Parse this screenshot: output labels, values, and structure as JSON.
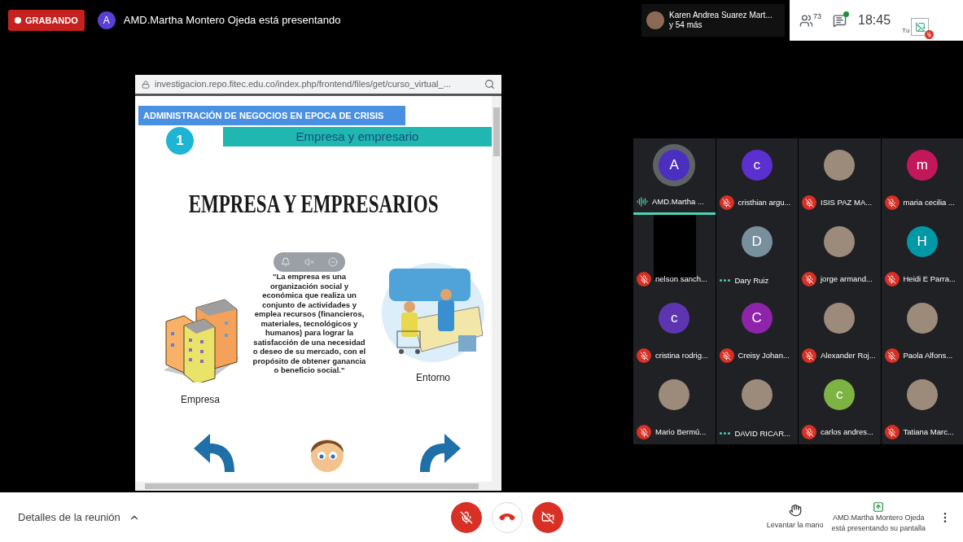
{
  "recording_badge": "GRABANDO",
  "presenter": {
    "initial": "A",
    "text": "AMD.Martha Montero Ojeda está presentando"
  },
  "pinned": {
    "name": "Karen Andrea Suarez Mart...",
    "more": "y 54 más"
  },
  "participants_count": "73",
  "chat_unread": true,
  "time": "18:45",
  "self": {
    "label": "Tú",
    "muted": true
  },
  "presentation": {
    "url": "investigacion.repo.fitec.edu.co/index.php/frontend/files/get/curso_virtual_...",
    "header": "ADMINISTRACIÓN DE NEGOCIOS EN EPOCA DE CRISIS",
    "number": "1",
    "section": "Empresa y empresario",
    "title": "EMPRESA Y EMPRESARIOS",
    "quote": "\"La empresa es una\norganización social y\neconómica que realiza un\nconjunto de actividades y\nemplea recursos (financieros,\nmateriales, tecnológicos y\nhumanos)  para lograr la\nsatisfacción de una necesidad\no deseo de su mercado, con el\npropósito de obtener ganancia\no beneficio social.\"",
    "left_caption": "Empresa",
    "right_caption": "Entorno"
  },
  "participants": [
    {
      "name": "AMD.Martha ...",
      "kind": "letter",
      "initial": "A",
      "color": "#4a2fc0",
      "muted": false,
      "speaking": true
    },
    {
      "name": "cristhian argu...",
      "kind": "letter",
      "initial": "c",
      "color": "#5b2fd0",
      "muted": true,
      "speaking": false
    },
    {
      "name": "ISIS PAZ MA...",
      "kind": "photo",
      "muted": true,
      "speaking": false
    },
    {
      "name": "maria cecilia ...",
      "kind": "letter",
      "initial": "m",
      "color": "#c2185b",
      "muted": true,
      "speaking": false
    },
    {
      "name": "nelson sanch...",
      "kind": "video",
      "muted": true,
      "speaking": false
    },
    {
      "name": "Dary Ruiz",
      "kind": "letter",
      "initial": "D",
      "color": "#78909c",
      "muted": false,
      "speaking": false
    },
    {
      "name": "jorge armand...",
      "kind": "photo",
      "muted": true,
      "speaking": false
    },
    {
      "name": "Heidi E Parra...",
      "kind": "letter",
      "initial": "H",
      "color": "#0097a7",
      "muted": true,
      "speaking": false
    },
    {
      "name": "cristina rodrig...",
      "kind": "letter",
      "initial": "c",
      "color": "#5e35b1",
      "muted": true,
      "speaking": false
    },
    {
      "name": "Creisy Johan...",
      "kind": "letter",
      "initial": "C",
      "color": "#8e24aa",
      "muted": true,
      "speaking": false
    },
    {
      "name": "Alexander Roj...",
      "kind": "photo",
      "muted": true,
      "speaking": false
    },
    {
      "name": "Paola Alfons...",
      "kind": "photo",
      "muted": true,
      "speaking": false
    },
    {
      "name": "Mario Bermú...",
      "kind": "photo",
      "muted": true,
      "speaking": false
    },
    {
      "name": "DAVID RICAR...",
      "kind": "photo",
      "muted": false,
      "speaking": false
    },
    {
      "name": "carlos andres...",
      "kind": "letter",
      "initial": "c",
      "color": "#7cb342",
      "muted": true,
      "speaking": false
    },
    {
      "name": "Tatiana Marc...",
      "kind": "photo",
      "muted": true,
      "speaking": false
    }
  ],
  "bottom": {
    "details": "Detalles de la reunión",
    "mic_on": false,
    "camera_on": false,
    "raise_hand": "Levantar la mano",
    "presenting_name": "AMD.Martha Montero Ojeda",
    "presenting_text": "está presentando su pantalla"
  }
}
